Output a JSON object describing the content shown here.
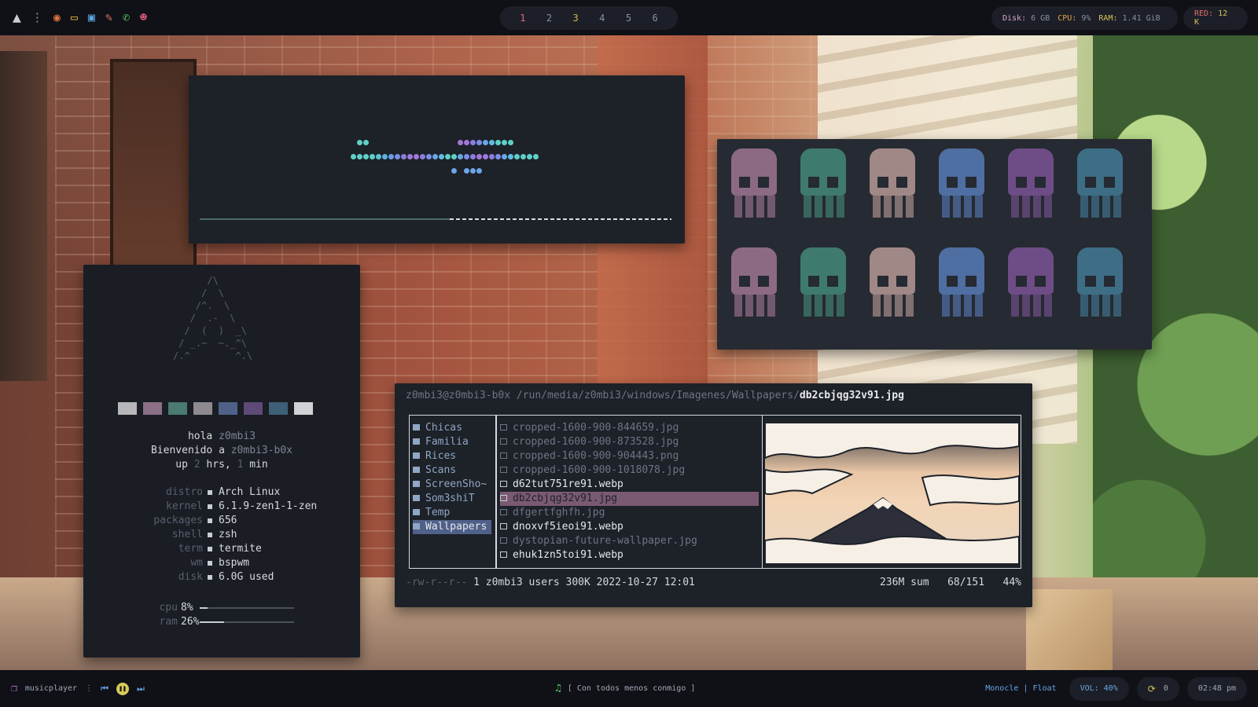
{
  "topbar": {
    "icons": [
      "arch-logo-icon",
      "kebab-menu-icon",
      "browser-icon",
      "folder-icon",
      "terminal-icon",
      "editor-icon",
      "whatsapp-icon",
      "discord-icon"
    ],
    "workspaces": [
      "1",
      "2",
      "3",
      "4",
      "5",
      "6"
    ],
    "workspace_colors": [
      "#e26a8a",
      "#8a8f9c",
      "#d9b64a",
      "#8a8f9c",
      "#8a8f9c",
      "#8a8f9c"
    ],
    "status": {
      "disk_label": "Disk:",
      "disk_value": "6 GB",
      "cpu_label": "CPU:",
      "cpu_value": "9%",
      "ram_label": "RAM:",
      "ram_value": "1.41 GiB",
      "net_label": "RED:",
      "net_value": "12 K"
    }
  },
  "fetch": {
    "greeting": {
      "hola": "hola",
      "user": "z0mbi3",
      "bienvenido": "Bienvenido a",
      "host": "z0mbi3-b0x",
      "up": "up",
      "hrs_value": "2",
      "hrs_label": "hrs,",
      "min_value": "1",
      "min_label": "min"
    },
    "rows": [
      {
        "key": "distro",
        "value": "Arch Linux"
      },
      {
        "key": "kernel",
        "value": "6.1.9-zen1-1-zen"
      },
      {
        "key": "packages",
        "value": "656"
      },
      {
        "key": "shell",
        "value": "zsh"
      },
      {
        "key": "term",
        "value": "termite"
      },
      {
        "key": "wm",
        "value": "bspwm"
      },
      {
        "key": "disk",
        "value": "6.0G used"
      }
    ],
    "meters": [
      {
        "key": "cpu",
        "value": "8%",
        "fraction": 0.08
      },
      {
        "key": "ram",
        "value": "26%",
        "fraction": 0.26
      }
    ],
    "swatch_colors": [
      "#b7b7bb",
      "#8a6f86",
      "#4a7a70",
      "#8f8a90",
      "#4f6189",
      "#5d4a77",
      "#3d5f77",
      "#d0d2d6"
    ]
  },
  "visualizer": {
    "progress": 0.53
  },
  "skulls": {
    "colors": [
      "#8c6a84",
      "#3f7a6e",
      "#a08886",
      "#4f6ea1",
      "#6e4c86",
      "#3d6e86"
    ]
  },
  "ranger": {
    "path_prefix": "z0mbi3@z0mbi3-b0x /run/media/z0mbi3/windows/Imagenes/Wallpapers/",
    "path_file": "db2cbjqg32v91.jpg",
    "folders": [
      "Chicas",
      "Familia",
      "Rices",
      "Scans",
      "ScreenSho~",
      "Som3shiT",
      "Temp",
      "Wallpapers"
    ],
    "selected_folder": 7,
    "files": [
      {
        "name": "cropped-1600-900-844659.jpg",
        "dim": true
      },
      {
        "name": "cropped-1600-900-873528.jpg",
        "dim": true
      },
      {
        "name": "cropped-1600-900-904443.png",
        "dim": true
      },
      {
        "name": "cropped-1600-900-1018078.jpg",
        "dim": true
      },
      {
        "name": "d62tut751re91.webp",
        "dim": false
      },
      {
        "name": "db2cbjqg32v91.jpg",
        "dim": false,
        "selected": true
      },
      {
        "name": "dfgertfghfh.jpg",
        "dim": true
      },
      {
        "name": "dnoxvf5ieoi91.webp",
        "dim": false
      },
      {
        "name": "dystopian-future-wallpaper.jpg",
        "dim": true
      },
      {
        "name": "ehuk1zn5toi91.webp",
        "dim": false
      }
    ],
    "status_perm": "-rw-r--r--",
    "status_info": "1 z0mbi3 users 300K 2022-10-27 12:01",
    "status_right": "236M sum   68/151   44%"
  },
  "bottombar": {
    "app_name": "musicplayer",
    "song": "[ Con todos menos conmigo ]",
    "layout": "Monocle | Float",
    "volume": "VOL: 40%",
    "updates": "0",
    "time": "02:48 pm"
  }
}
